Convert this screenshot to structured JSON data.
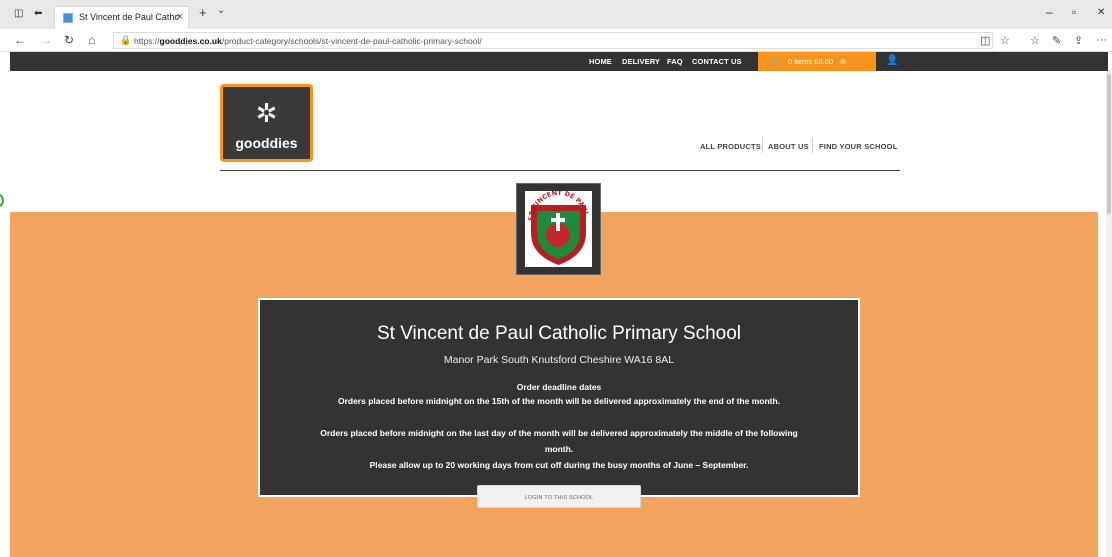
{
  "browser": {
    "tab_title": "St Vincent de Paul Cathc",
    "url_prefix": "https://",
    "url_host": "gooddies.co.uk",
    "url_path": "/product-category/schools/st-vincent-de-paul-catholic-primary-school/"
  },
  "icons": {
    "tab_actions": "◫",
    "tab_back": "⬅",
    "tab_close": "×",
    "new_tab": "+",
    "tab_menu": "⌄",
    "minimize": "–",
    "maximize": "▫",
    "close": "✕",
    "back": "←",
    "forward": "→",
    "refresh": "↻",
    "home": "⌂",
    "lock": "🔒",
    "reading": "◫",
    "favorite": "☆",
    "favorites": "☆",
    "pen": "✎",
    "share": "⇪",
    "more": "···",
    "cart": "🛒",
    "cart_arrow": "⊕",
    "user": "👤"
  },
  "topnav": {
    "home": "HOME",
    "delivery": "DELIVERY",
    "faq": "FAQ",
    "contact": "CONTACT US",
    "cart_label": "0 items £0.00"
  },
  "header": {
    "logo_mark": "✲",
    "logo_text": "gooddies",
    "nav_all_products": "ALL PRODUCTS",
    "nav_about_us": "ABOUT US",
    "nav_find_school": "FIND YOUR SCHOOL"
  },
  "crest_text": "ST VINCENT DE PAUL",
  "school": {
    "name": "St Vincent de Paul Catholic Primary School",
    "address": "Manor Park South Knutsford Cheshire WA16 8AL",
    "deadline_heading": "Order deadline dates",
    "line1": "Orders placed before midnight on the 15th of the month will be delivered approximately the end of the month.",
    "line2": "Orders placed before midnight on the last day of the month will be delivered approximately the middle of the following month.",
    "line3": "Please allow up to 20 working days from cut off during the busy months of June – September.",
    "login_button": "LOGIN TO THIS SCHOOL"
  },
  "colors": {
    "accent": "#f7941d",
    "band": "#f2a35e",
    "dark": "#333333"
  }
}
